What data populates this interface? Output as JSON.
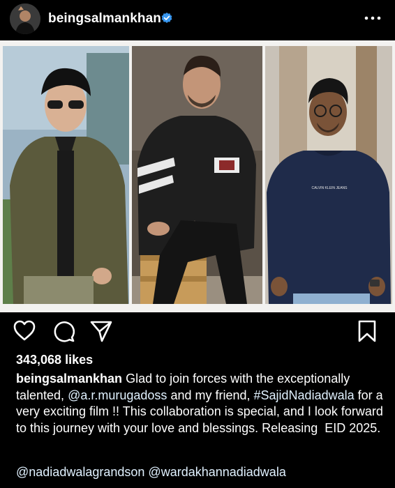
{
  "header": {
    "username": "beingsalmankhan",
    "verified_icon": "verified-badge-icon",
    "more_icon": "more-options-icon"
  },
  "post": {
    "image_panels": [
      "person-in-green-jacket",
      "person-in-leather-jacket",
      "person-in-navy-sweater"
    ],
    "sweater_logo": "CALVIN KLEIN JEANS"
  },
  "actions": {
    "like_icon": "heart-icon",
    "comment_icon": "comment-icon",
    "share_icon": "send-icon",
    "save_icon": "bookmark-icon"
  },
  "likes": "343,068 likes",
  "caption": {
    "username": "beingsalmankhan",
    "text_1": "Glad to join forces with the exceptionally talented,",
    "mention_1": "@a.r.murugadoss",
    "text_2": "and my friend,",
    "hashtag_1": "#SajidNadiadwala",
    "text_3": "for a very exciting film !! This collaboration is special, and I look forward to this journey with your love and blessings. Releasing  EID 2025."
  },
  "tags": {
    "mention_1": "@nadiadwalagrandson",
    "mention_2": "@wardakhannadiadwala"
  },
  "colors": {
    "background": "#000000",
    "text": "#ffffff",
    "verified": "#3897f0",
    "link": "#e0f1ff"
  }
}
